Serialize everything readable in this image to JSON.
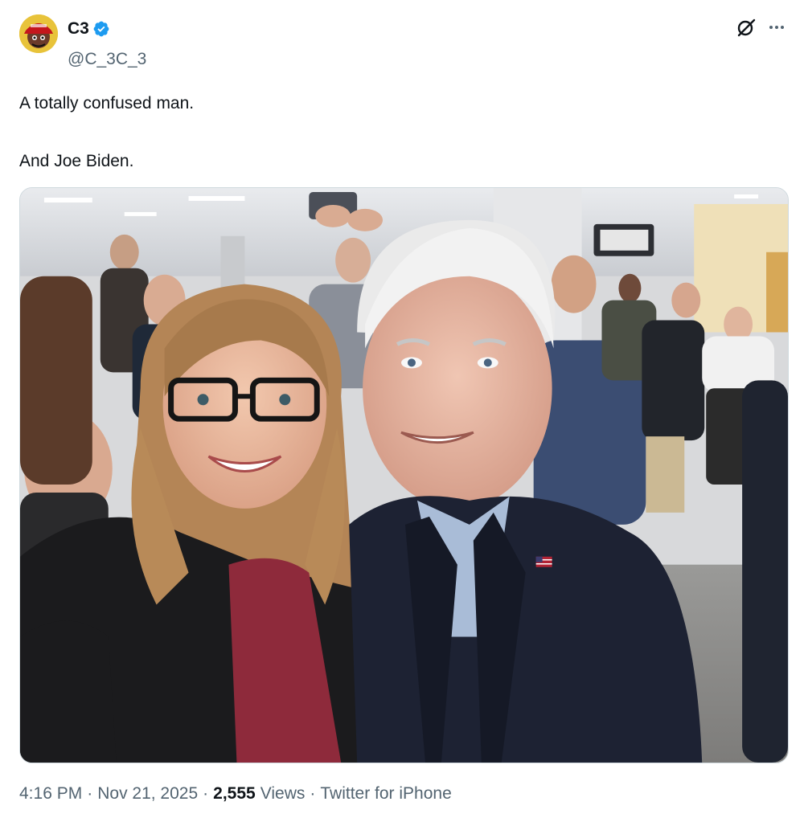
{
  "author": {
    "display_name": "C3",
    "handle": "@C_3C_3",
    "verified": true,
    "verified_color": "#1d9bf0",
    "avatar_icon": "avatar-red-cap-icon"
  },
  "actions": {
    "grok_icon": "grok-icon",
    "more_icon": "more-icon"
  },
  "tweet": {
    "line1": "A totally confused man.",
    "line2": "And Joe Biden."
  },
  "media": {
    "icon": "photo-icon"
  },
  "meta": {
    "time": "4:16 PM",
    "date": "Nov 21, 2025",
    "views_count": "2,555",
    "views_label": "Views",
    "source": "Twitter for iPhone",
    "separator": "·"
  },
  "colors": {
    "text_primary": "#0f1419",
    "text_secondary": "#536471",
    "border": "#cfd9de"
  }
}
